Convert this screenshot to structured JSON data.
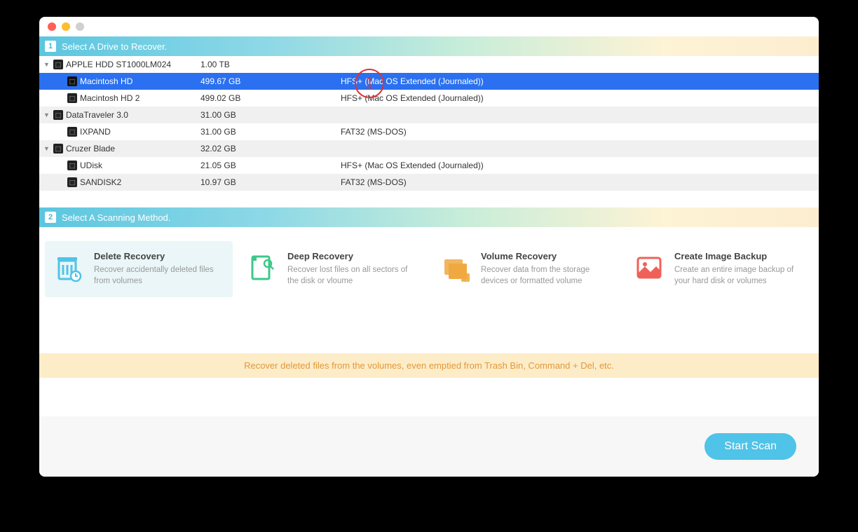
{
  "section1": {
    "num": "1",
    "title": "Select A Drive to Recover."
  },
  "section2": {
    "num": "2",
    "title": "Select A Scanning Method."
  },
  "drives": [
    {
      "name": "APPLE HDD ST1000LM024",
      "size": "1.00 TB",
      "fs": "",
      "parent": true,
      "indent": 0
    },
    {
      "name": "Macintosh HD",
      "size": "499.67 GB",
      "fs": "HFS+ (Mac OS Extended (Journaled))",
      "sel": true,
      "indent": 1
    },
    {
      "name": "Macintosh HD 2",
      "size": "499.02 GB",
      "fs": "HFS+ (Mac OS Extended (Journaled))",
      "indent": 1
    },
    {
      "name": "DataTraveler 3.0",
      "size": "31.00 GB",
      "fs": "",
      "parent": true,
      "indent": 0,
      "alt": true
    },
    {
      "name": "IXPAND",
      "size": "31.00 GB",
      "fs": "FAT32 (MS-DOS)",
      "indent": 1
    },
    {
      "name": "Cruzer Blade",
      "size": "32.02 GB",
      "fs": "",
      "parent": true,
      "indent": 0,
      "alt": true
    },
    {
      "name": "UDisk",
      "size": "21.05 GB",
      "fs": "HFS+ (Mac OS Extended (Journaled))",
      "indent": 1
    },
    {
      "name": "SANDISK2",
      "size": "10.97 GB",
      "fs": "FAT32 (MS-DOS)",
      "indent": 1,
      "alt": true
    }
  ],
  "methods": [
    {
      "title": "Delete Recovery",
      "desc": "Recover accidentally deleted files from volumes",
      "color": "#4fc3e8",
      "active": true
    },
    {
      "title": "Deep Recovery",
      "desc": "Recover lost files on all sectors of the disk or vloume",
      "color": "#3cc88a"
    },
    {
      "title": "Volume Recovery",
      "desc": "Recover data from the storage devices or formatted volume",
      "color": "#f0a940"
    },
    {
      "title": "Create Image Backup",
      "desc": "Create an entire image backup of your hard disk or volumes",
      "color": "#f0605a"
    }
  ],
  "hint": "Recover deleted files from the volumes, even emptied from Trash Bin, Command + Del, etc.",
  "startBtn": "Start Scan",
  "annot": "1"
}
